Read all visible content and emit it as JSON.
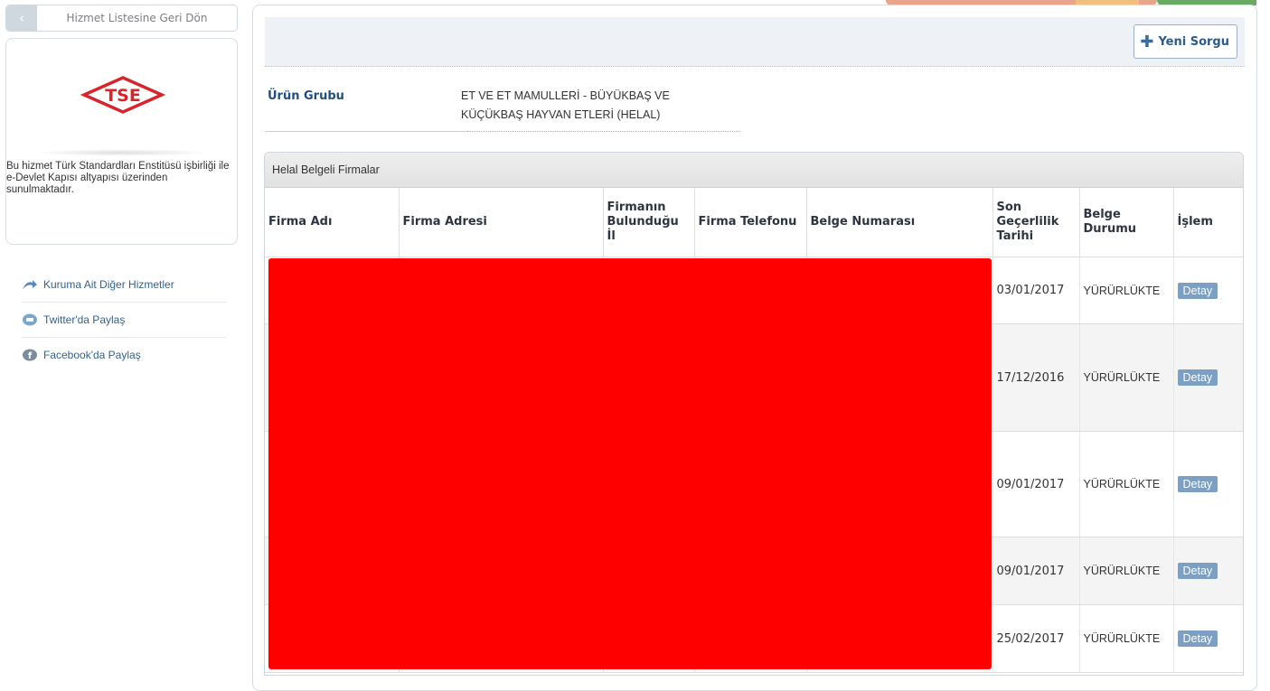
{
  "sidebar": {
    "back_label": "Hizmet Listesine Geri Dön",
    "logo_text": "TSE",
    "info_text": "Bu hizmet Türk Standardları Enstitüsü işbirliği ile e-Devlet Kapısı altyapısı üzerinden sunulmaktadır.",
    "links": [
      {
        "label": "Kuruma Ait Diğer Hizmetler",
        "icon": "arrow-icon"
      },
      {
        "label": "Twitter'da Paylaş",
        "icon": "twitter-icon"
      },
      {
        "label": "Facebook'da Paylaş",
        "icon": "facebook-icon"
      }
    ]
  },
  "main": {
    "new_query_label": "Yeni Sorgu",
    "product_group_label": "Ürün Grubu",
    "product_group_value": "ET VE ET MAMULLERİ - BÜYÜKBAŞ VE KÜÇÜKBAŞ HAYVAN ETLERİ (HELAL)",
    "table_title": "Helal Belgeli Firmalar",
    "columns": [
      "Firma Adı",
      "Firma Adresi",
      "Firmanın Bulunduğu İl",
      "Firma Telefonu",
      "Belge Numarası",
      "Son Geçerlilik Tarihi",
      "Belge Durumu",
      "İşlem"
    ],
    "rows": [
      {
        "date": "03/01/2017",
        "status": "YÜRÜRLÜKTE",
        "action": "Detay"
      },
      {
        "date": "17/12/2016",
        "status": "YÜRÜRLÜKTE",
        "action": "Detay"
      },
      {
        "date": "09/01/2017",
        "status": "YÜRÜRLÜKTE",
        "action": "Detay"
      },
      {
        "date": "09/01/2017",
        "status": "YÜRÜRLÜKTE",
        "action": "Detay"
      },
      {
        "date": "25/02/2017",
        "status": "YÜRÜRLÜKTE",
        "action": "Detay"
      }
    ]
  },
  "colors": {
    "accent": "#1f4f7e",
    "button": "#7d9fc1",
    "redaction": "#ff0000"
  }
}
